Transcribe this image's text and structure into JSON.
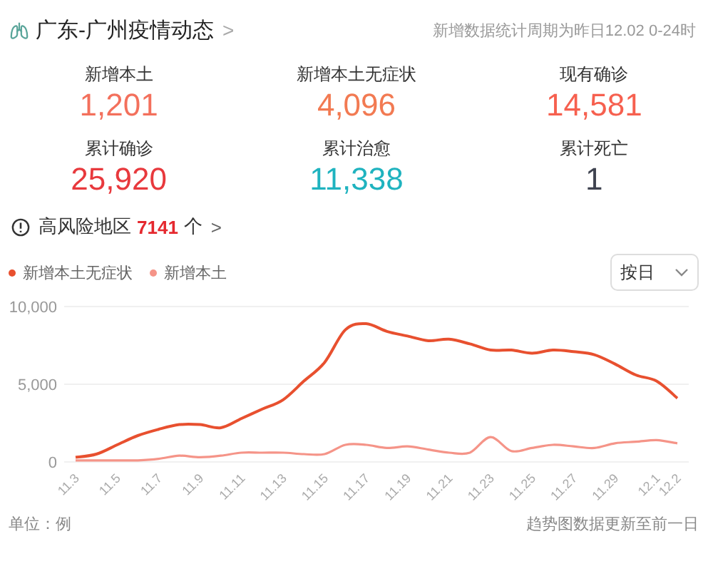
{
  "header": {
    "title": "广东-广州疫情动态",
    "chevron": ">",
    "note": "新增数据统计周期为昨日12.02 0-24时"
  },
  "stats": [
    {
      "label": "新增本土",
      "value": "1,201",
      "color": "#f3705c"
    },
    {
      "label": "新增本土无症状",
      "value": "4,096",
      "color": "#f27a52"
    },
    {
      "label": "现有确诊",
      "value": "14,581",
      "color": "#f6604f"
    },
    {
      "label": "累计确诊",
      "value": "25,920",
      "color": "#e8393d"
    },
    {
      "label": "累计治愈",
      "value": "11,338",
      "color": "#1fb3bf"
    },
    {
      "label": "累计死亡",
      "value": "1",
      "color": "#3f4350"
    }
  ],
  "risk": {
    "label": "高风险地区",
    "count": "7141",
    "unit": "个",
    "chevron": ">"
  },
  "dropdown": {
    "value": "按日"
  },
  "chart_data": {
    "type": "line",
    "categories": [
      "11.3",
      null,
      "11.5",
      null,
      "11.7",
      null,
      "11.9",
      null,
      "11.11",
      null,
      "11.13",
      null,
      "11.15",
      null,
      "11.17",
      null,
      "11.19",
      null,
      "11.21",
      null,
      "11.23",
      null,
      "11.25",
      null,
      "11.27",
      null,
      "11.29",
      null,
      "12.1",
      "12.2"
    ],
    "series": [
      {
        "name": "新增本土无症状",
        "color": "#e8502f",
        "values": [
          300,
          500,
          1100,
          1700,
          2100,
          2400,
          2400,
          2200,
          2800,
          3400,
          4000,
          5200,
          6400,
          8500,
          8900,
          8400,
          8100,
          7800,
          7900,
          7600,
          7200,
          7200,
          7000,
          7200,
          7100,
          6900,
          6300,
          5600,
          5200,
          4100
        ]
      },
      {
        "name": "新增本土",
        "color": "#f59488",
        "values": [
          100,
          100,
          100,
          100,
          200,
          400,
          300,
          400,
          600,
          600,
          600,
          500,
          500,
          1100,
          1100,
          900,
          1000,
          800,
          600,
          600,
          1600,
          700,
          900,
          1100,
          1000,
          900,
          1200,
          1300,
          1400,
          1200
        ]
      }
    ],
    "ylim": [
      0,
      10000
    ],
    "yticks": [
      {
        "value": 0,
        "label": "0"
      },
      {
        "value": 5000,
        "label": "5,000"
      },
      {
        "value": 10000,
        "label": "10,000"
      }
    ]
  },
  "footer": {
    "unit": "单位：例",
    "note": "趋势图数据更新至前一日"
  }
}
